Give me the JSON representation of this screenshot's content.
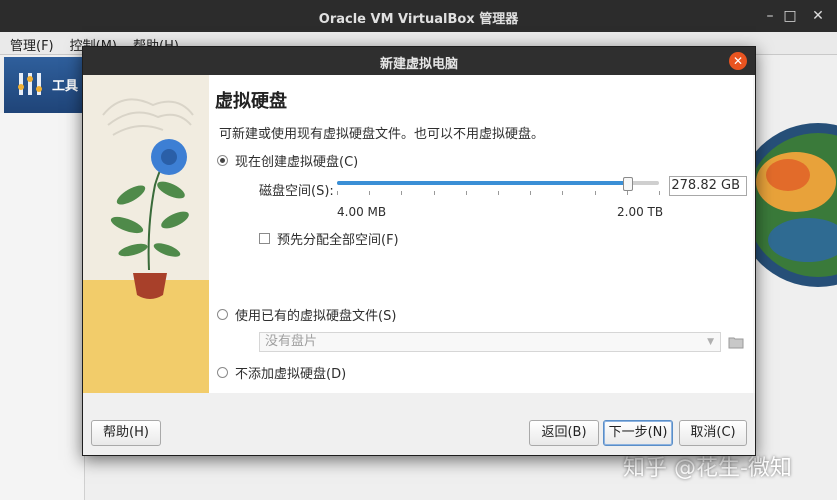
{
  "main_window": {
    "title": "Oracle VM VirtualBox 管理器",
    "menu": [
      "管理(F)",
      "控制(M)",
      "帮助(H)"
    ],
    "tools_label": "工具"
  },
  "dialog": {
    "title": "新建虚拟电脑",
    "heading": "虚拟硬盘",
    "description": "可新建或使用现有虚拟硬盘文件。也可以不用虚拟硬盘。",
    "options": {
      "create_new": "现在创建虚拟硬盘(C)",
      "use_existing": "使用已有的虚拟硬盘文件(S)",
      "no_disk": "不添加虚拟硬盘(D)"
    },
    "selected_option": "create_new",
    "disk_size": {
      "label": "磁盘空间(S):",
      "value": "278.82 GB",
      "min_label": "4.00 MB",
      "max_label": "2.00 TB",
      "slider_fraction": 0.9
    },
    "preallocate": {
      "label": "预先分配全部空间(F)",
      "checked": false
    },
    "existing_file_placeholder": "没有盘片",
    "buttons": {
      "help": "帮助(H)",
      "back": "返回(B)",
      "next": "下一步(N)",
      "cancel": "取消(C)"
    }
  },
  "watermark": "知乎 @花生-微知",
  "colors": {
    "accent": "#3a8fd6",
    "close": "#e95420",
    "titlebar": "#2f2f2f"
  }
}
